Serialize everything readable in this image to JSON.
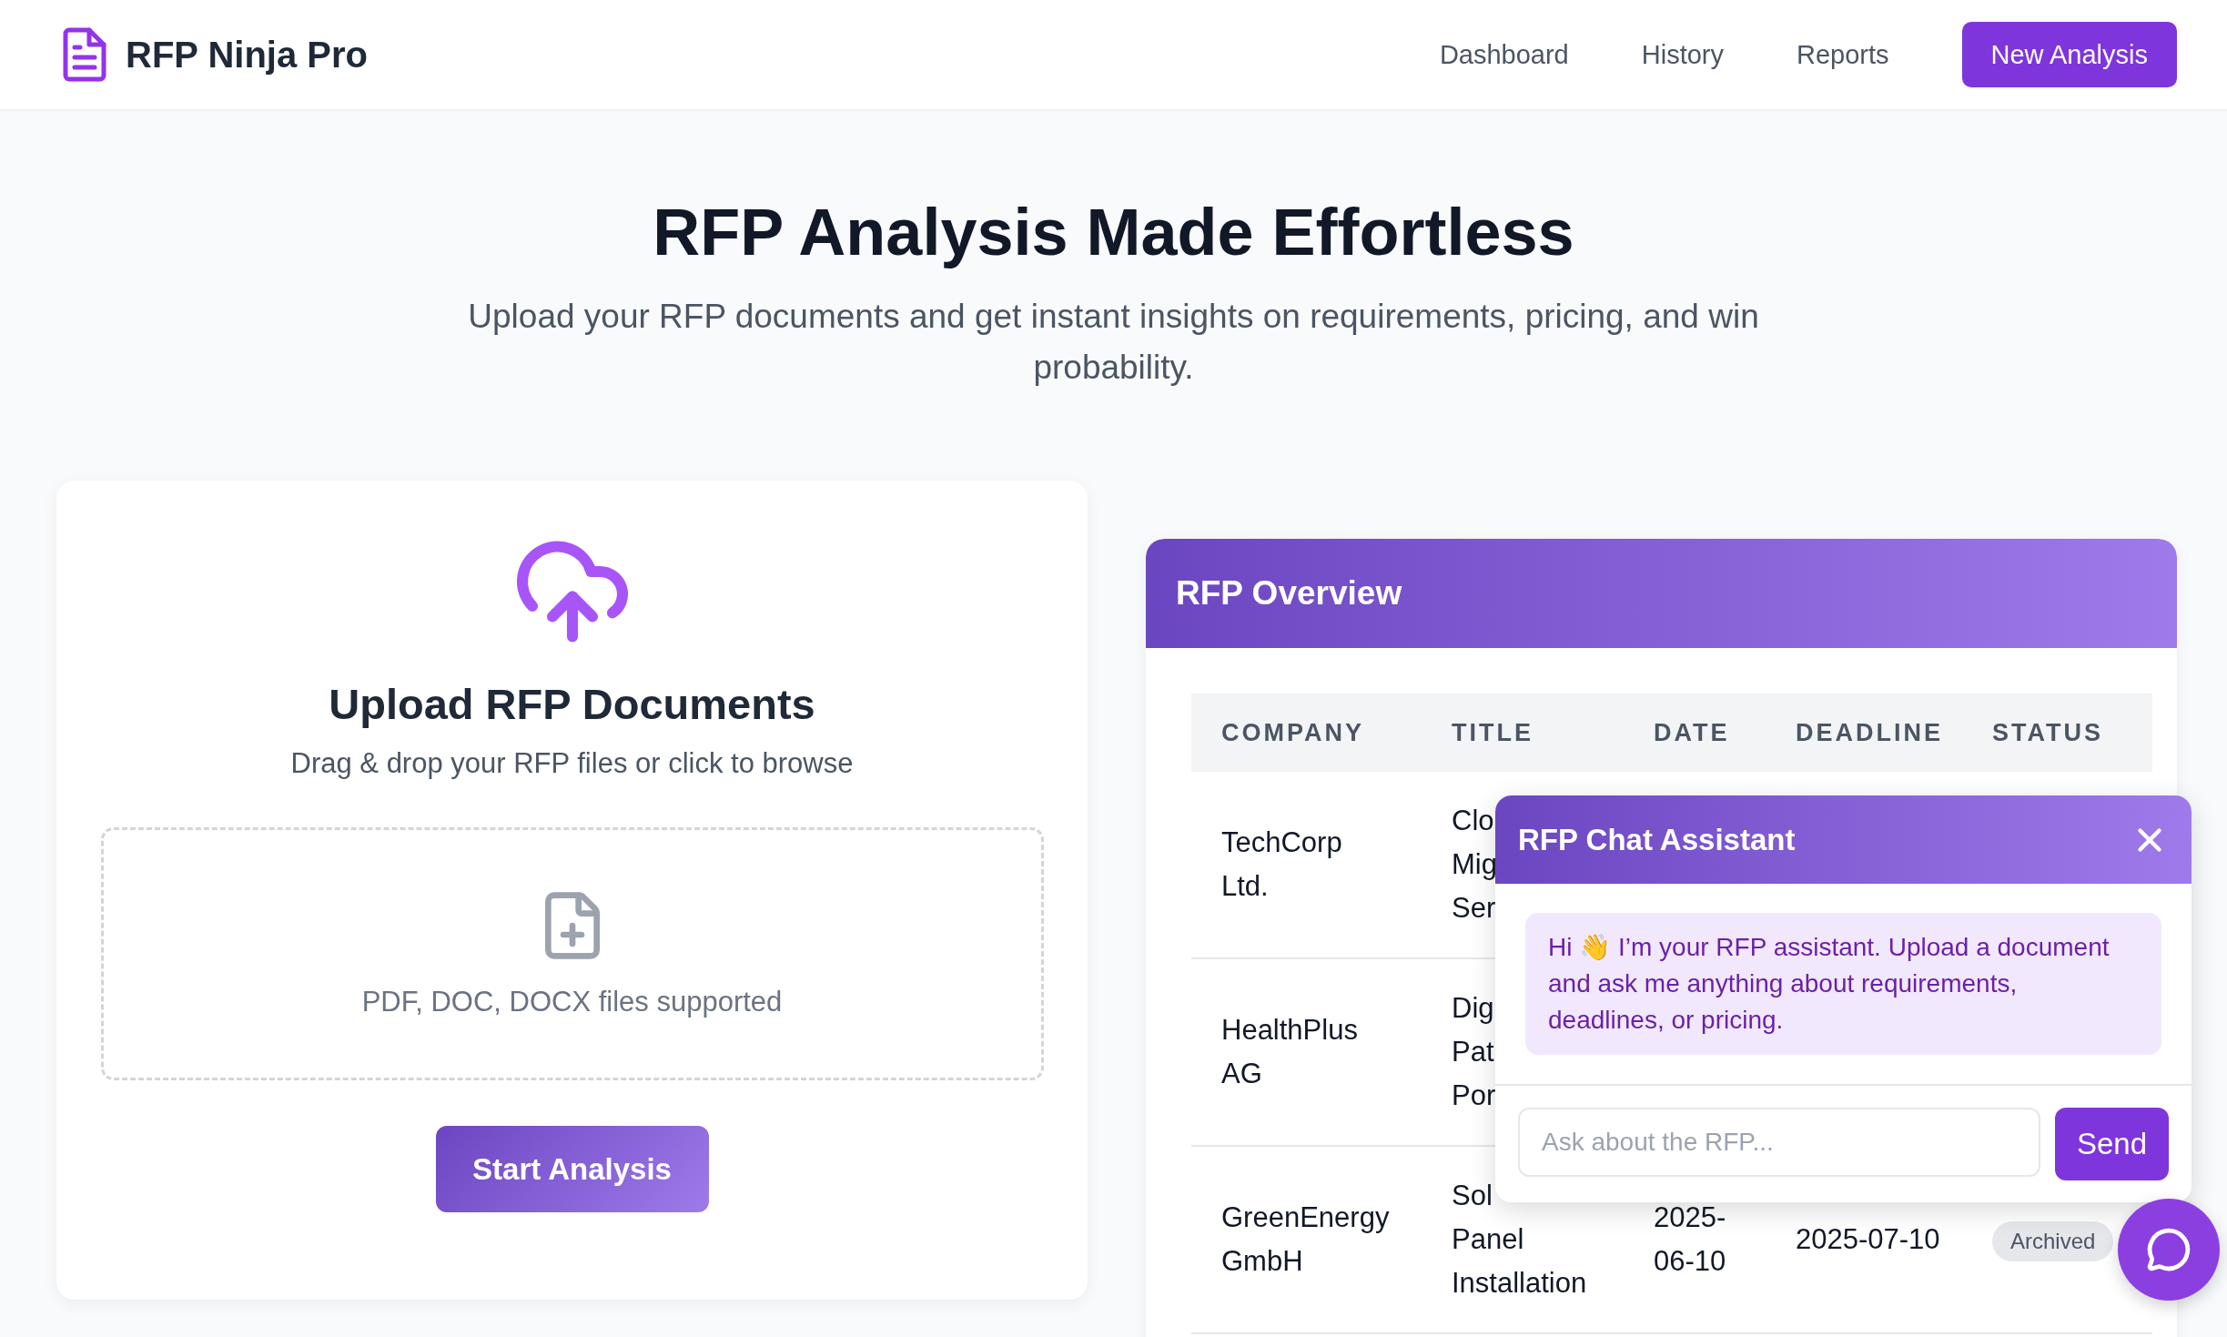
{
  "header": {
    "brand": "RFP Ninja Pro",
    "nav": [
      {
        "label": "Dashboard",
        "selected": false
      },
      {
        "label": "History",
        "selected": false
      },
      {
        "label": "Reports",
        "selected": false
      }
    ],
    "cta": "New Analysis"
  },
  "hero": {
    "title": "RFP Analysis Made Effortless",
    "subtitle": "Upload your RFP documents and get instant insights on requirements, pricing, and win probability."
  },
  "upload": {
    "title": "Upload RFP Documents",
    "subtitle": "Drag & drop your RFP files or click to browse",
    "dropzone_text": "PDF, DOC, DOCX files supported",
    "button": "Start Analysis"
  },
  "overview": {
    "title": "RFP Overview",
    "columns": [
      "COMPANY",
      "TITLE",
      "DATE",
      "DEADLINE",
      "STATUS"
    ],
    "rows": [
      {
        "company": "TechCorp Ltd.",
        "title": "Clo\nMig\nSer"
      },
      {
        "company": "HealthPlus AG",
        "title": "Dig\nPat\nPor"
      },
      {
        "company": "GreenEnergy GmbH",
        "title": "Sol\nPanel\nInstallation",
        "date": "2025-06-10",
        "deadline": "2025-07-10",
        "status": "Archived"
      }
    ]
  },
  "chat": {
    "title": "RFP Chat Assistant",
    "message": "Hi 👋 I’m your RFP assistant. Upload a document and ask me anything about requirements, deadlines, or pricing.",
    "placeholder": "Ask about the RFP...",
    "send": "Send"
  }
}
